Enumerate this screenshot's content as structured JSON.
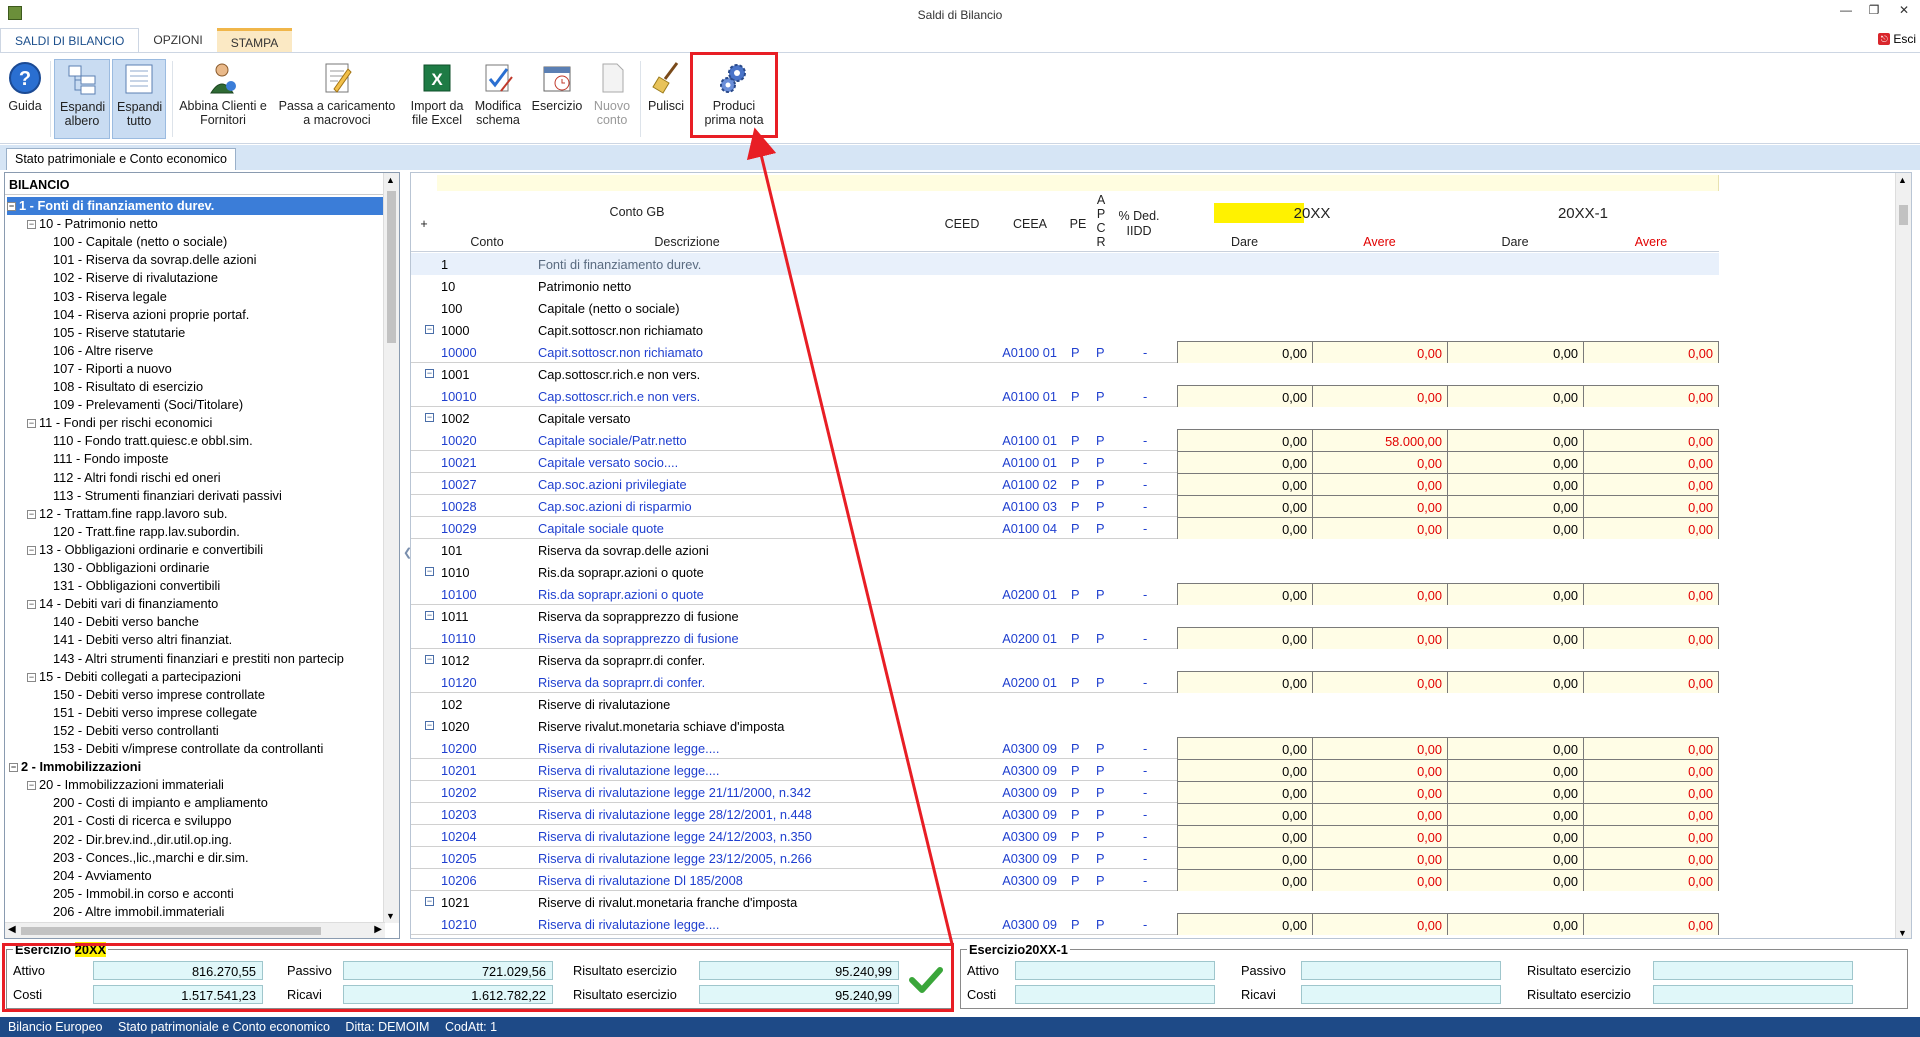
{
  "window": {
    "title": "Saldi di Bilancio",
    "exit_label": "Esci"
  },
  "ribbon_tabs": [
    "SALDI DI BILANCIO",
    "OPZIONI",
    "STAMPA"
  ],
  "ribbon": {
    "guida": "Guida",
    "espandi_albero": "Espandi albero",
    "espandi_tutto": "Espandi tutto",
    "abbina": "Abbina Clienti e Fornitori",
    "passa": "Passa a caricamento a macrovoci",
    "import": "Import da file Excel",
    "modifica": "Modifica schema",
    "esercizio": "Esercizio",
    "nuovo": "Nuovo conto",
    "pulisci": "Pulisci",
    "produci": "Produci prima nota"
  },
  "doc_tab": "Stato patrimoniale e Conto economico",
  "tree": {
    "header": "BILANCIO",
    "nodes": [
      "1 - Fonti di finanziamento durev.",
      "10 - Patrimonio netto",
      "100 - Capitale (netto o sociale)",
      "101 - Riserva da sovrap.delle azioni",
      "102 - Riserve di rivalutazione",
      "103 - Riserva legale",
      "104 - Riserva azioni proprie portaf.",
      "105 - Riserve statutarie",
      "106 - Altre riserve",
      "107 - Riporti a nuovo",
      "108 - Risultato di esercizio",
      "109 - Prelevamenti (Soci/Titolare)",
      "11 - Fondi per rischi economici",
      "110 - Fondo tratt.quiesc.e obbl.sim.",
      "111 - Fondo imposte",
      "112 - Altri fondi rischi ed oneri",
      "113 - Strumenti finanziari derivati passivi",
      "12 - Trattam.fine rapp.lavoro sub.",
      "120 - Tratt.fine rapp.lav.subordin.",
      "13 - Obbligazioni ordinarie e convertibili",
      "130 - Obbligazioni ordinarie",
      "131 - Obbligazioni convertibili",
      "14 - Debiti vari di finanziamento",
      "140 - Debiti verso banche",
      "141 - Debiti verso altri finanziat.",
      "143 - Altri strumenti finanziari e prestiti non partecip",
      "15 - Debiti collegati a partecipazioni",
      "150 - Debiti verso imprese controllate",
      "151 - Debiti verso imprese collegate",
      "152 - Debiti verso controllanti",
      "153 - Debiti v/imprese controllate da controllanti",
      "2 - Immobilizzazioni",
      "20 - Immobilizzazioni immateriali",
      "200 - Costi di impianto e ampliamento",
      "201 - Costi di ricerca e sviluppo",
      "202 - Dir.brev.ind.,dir.util.op.ing.",
      "203 - Conces.,lic.,marchi e dir.sim.",
      "204 - Avviamento",
      "205 - Immobil.in corso e acconti",
      "206 - Altre immobil.immateriali"
    ]
  },
  "grid": {
    "headers": {
      "plus": "+",
      "conto_gb": "Conto GB",
      "conto": "Conto",
      "descrizione": "Descrizione",
      "ceed": "CEED",
      "ceea": "CEEA",
      "pe": "PE",
      "apcr": [
        "A",
        "P",
        "C",
        "R"
      ],
      "ded_line1": "% Ded.",
      "ded_line2": "IIDD",
      "year1": "20XX",
      "year2": "20XX-1",
      "dare": "Dare",
      "avere": "Avere"
    },
    "rows": [
      {
        "conto": "1",
        "desc": "Fonti di finanziamento durev.",
        "type": "top"
      },
      {
        "conto": "10",
        "desc": "Patrimonio netto",
        "type": "group"
      },
      {
        "conto": "100",
        "desc": "Capitale (netto o sociale)",
        "type": "group"
      },
      {
        "conto": "1000",
        "desc": "Capit.sottoscr.non richiamato",
        "type": "sub"
      },
      {
        "conto": "10000",
        "desc": "Capit.sottoscr.non richiamato",
        "type": "leaf",
        "ceea": "A0100 01",
        "pe": "P",
        "apcr": "P",
        "ded": "-",
        "d1": "0,00",
        "a1": "0,00",
        "d2": "0,00",
        "a2": "0,00"
      },
      {
        "conto": "1001",
        "desc": "Cap.sottoscr.rich.e non vers.",
        "type": "sub"
      },
      {
        "conto": "10010",
        "desc": "Cap.sottoscr.rich.e non vers.",
        "type": "leaf",
        "ceea": "A0100 01",
        "pe": "P",
        "apcr": "P",
        "ded": "-",
        "d1": "0,00",
        "a1": "0,00",
        "d2": "0,00",
        "a2": "0,00"
      },
      {
        "conto": "1002",
        "desc": "Capitale versato",
        "type": "sub"
      },
      {
        "conto": "10020",
        "desc": "Capitale sociale/Patr.netto",
        "type": "leaf",
        "ceea": "A0100 01",
        "pe": "P",
        "apcr": "P",
        "ded": "-",
        "d1": "0,00",
        "a1": "58.000,00",
        "d2": "0,00",
        "a2": "0,00"
      },
      {
        "conto": "10021",
        "desc": "Capitale versato socio....",
        "type": "leaf",
        "ceea": "A0100 01",
        "pe": "P",
        "apcr": "P",
        "ded": "-",
        "d1": "0,00",
        "a1": "0,00",
        "d2": "0,00",
        "a2": "0,00"
      },
      {
        "conto": "10027",
        "desc": "Cap.soc.azioni privilegiate",
        "type": "leaf",
        "ceea": "A0100 02",
        "pe": "P",
        "apcr": "P",
        "ded": "-",
        "d1": "0,00",
        "a1": "0,00",
        "d2": "0,00",
        "a2": "0,00"
      },
      {
        "conto": "10028",
        "desc": "Cap.soc.azioni di risparmio",
        "type": "leaf",
        "ceea": "A0100 03",
        "pe": "P",
        "apcr": "P",
        "ded": "-",
        "d1": "0,00",
        "a1": "0,00",
        "d2": "0,00",
        "a2": "0,00"
      },
      {
        "conto": "10029",
        "desc": "Capitale sociale quote",
        "type": "leaf",
        "ceea": "A0100 04",
        "pe": "P",
        "apcr": "P",
        "ded": "-",
        "d1": "0,00",
        "a1": "0,00",
        "d2": "0,00",
        "a2": "0,00"
      },
      {
        "conto": "101",
        "desc": "Riserva da sovrap.delle azioni",
        "type": "group"
      },
      {
        "conto": "1010",
        "desc": "Ris.da soprapr.azioni o quote",
        "type": "sub"
      },
      {
        "conto": "10100",
        "desc": "Ris.da soprapr.azioni o quote",
        "type": "leaf",
        "ceea": "A0200 01",
        "pe": "P",
        "apcr": "P",
        "ded": "-",
        "d1": "0,00",
        "a1": "0,00",
        "d2": "0,00",
        "a2": "0,00"
      },
      {
        "conto": "1011",
        "desc": "Riserva da soprapprezzo di fusione",
        "type": "sub"
      },
      {
        "conto": "10110",
        "desc": "Riserva da soprapprezzo di fusione",
        "type": "leaf",
        "ceea": "A0200 01",
        "pe": "P",
        "apcr": "P",
        "ded": "-",
        "d1": "0,00",
        "a1": "0,00",
        "d2": "0,00",
        "a2": "0,00"
      },
      {
        "conto": "1012",
        "desc": "Riserva da sopraprr.di confer.",
        "type": "sub"
      },
      {
        "conto": "10120",
        "desc": "Riserva da sopraprr.di confer.",
        "type": "leaf",
        "ceea": "A0200 01",
        "pe": "P",
        "apcr": "P",
        "ded": "-",
        "d1": "0,00",
        "a1": "0,00",
        "d2": "0,00",
        "a2": "0,00"
      },
      {
        "conto": "102",
        "desc": "Riserve di rivalutazione",
        "type": "group"
      },
      {
        "conto": "1020",
        "desc": "Riserve rivalut.monetaria schiave d'imposta",
        "type": "sub"
      },
      {
        "conto": "10200",
        "desc": "Riserva di rivalutazione legge....",
        "type": "leaf",
        "ceea": "A0300 09",
        "pe": "P",
        "apcr": "P",
        "ded": "-",
        "d1": "0,00",
        "a1": "0,00",
        "d2": "0,00",
        "a2": "0,00"
      },
      {
        "conto": "10201",
        "desc": "Riserva di rivalutazione legge....",
        "type": "leaf",
        "ceea": "A0300 09",
        "pe": "P",
        "apcr": "P",
        "ded": "-",
        "d1": "0,00",
        "a1": "0,00",
        "d2": "0,00",
        "a2": "0,00"
      },
      {
        "conto": "10202",
        "desc": "Riserva di rivalutazione legge 21/11/2000, n.342",
        "type": "leaf",
        "ceea": "A0300 09",
        "pe": "P",
        "apcr": "P",
        "ded": "-",
        "d1": "0,00",
        "a1": "0,00",
        "d2": "0,00",
        "a2": "0,00"
      },
      {
        "conto": "10203",
        "desc": "Riserva di rivalutazione legge 28/12/2001, n.448",
        "type": "leaf",
        "ceea": "A0300 09",
        "pe": "P",
        "apcr": "P",
        "ded": "-",
        "d1": "0,00",
        "a1": "0,00",
        "d2": "0,00",
        "a2": "0,00"
      },
      {
        "conto": "10204",
        "desc": "Riserva di rivalutazione legge 24/12/2003, n.350",
        "type": "leaf",
        "ceea": "A0300 09",
        "pe": "P",
        "apcr": "P",
        "ded": "-",
        "d1": "0,00",
        "a1": "0,00",
        "d2": "0,00",
        "a2": "0,00"
      },
      {
        "conto": "10205",
        "desc": "Riserva di rivalutazione legge 23/12/2005, n.266",
        "type": "leaf",
        "ceea": "A0300 09",
        "pe": "P",
        "apcr": "P",
        "ded": "-",
        "d1": "0,00",
        "a1": "0,00",
        "d2": "0,00",
        "a2": "0,00"
      },
      {
        "conto": "10206",
        "desc": "Riserva di rivalutazione Dl 185/2008",
        "type": "leaf",
        "ceea": "A0300 09",
        "pe": "P",
        "apcr": "P",
        "ded": "-",
        "d1": "0,00",
        "a1": "0,00",
        "d2": "0,00",
        "a2": "0,00"
      },
      {
        "conto": "1021",
        "desc": "Riserve di rivalut.monetaria franche d'imposta",
        "type": "sub"
      },
      {
        "conto": "10210",
        "desc": "Riserva di rivalutazione legge....",
        "type": "leaf",
        "ceea": "A0300 09",
        "pe": "P",
        "apcr": "P",
        "ded": "-",
        "d1": "0,00",
        "a1": "0,00",
        "d2": "0,00",
        "a2": "0,00"
      }
    ]
  },
  "footer": {
    "left": {
      "title_prefix": "Esercizio",
      "title_year": "20XX",
      "attivo_label": "Attivo",
      "attivo": "816.270,55",
      "passivo_label": "Passivo",
      "passivo": "721.029,56",
      "ris1_label": "Risultato esercizio",
      "ris1": "95.240,99",
      "costi_label": "Costi",
      "costi": "1.517.541,23",
      "ricavi_label": "Ricavi",
      "ricavi": "1.612.782,22",
      "ris2_label": "Risultato esercizio",
      "ris2": "95.240,99"
    },
    "right": {
      "title": "Esercizio20XX-1",
      "attivo_label": "Attivo",
      "passivo_label": "Passivo",
      "ris1_label": "Risultato esercizio",
      "costi_label": "Costi",
      "ricavi_label": "Ricavi",
      "ris2_label": "Risultato esercizio"
    }
  },
  "status": [
    "Bilancio Europeo",
    "Stato patrimoniale e Conto economico",
    "Ditta: DEMOIM",
    "CodAtt: 1"
  ],
  "colors": {
    "accent": "#1e4a87",
    "highlight_red": "#e81e25",
    "leaf_blue": "#1f3fcf",
    "avere_red": "#e10000",
    "year_yellow": "#fff200"
  }
}
